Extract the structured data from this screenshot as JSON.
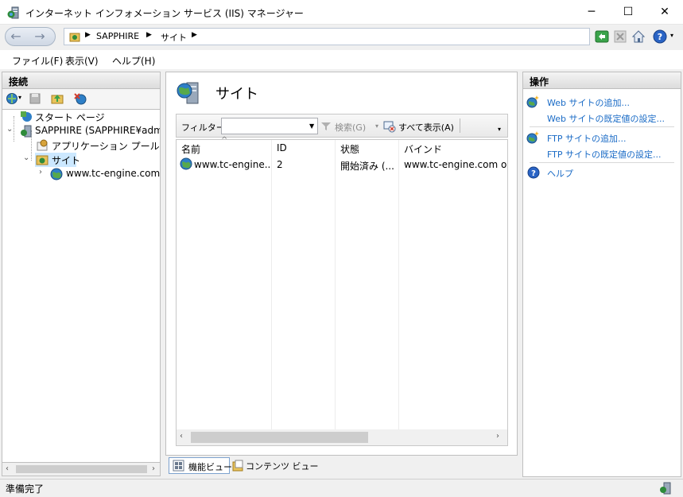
{
  "window": {
    "title": "インターネット インフォメーション サービス (IIS) マネージャー",
    "minimize": "─",
    "maximize": "☐",
    "close": "✕"
  },
  "address": {
    "back": "←",
    "forward": "→",
    "separator": "▶",
    "crumbs": [
      "SAPPHIRE",
      "サイト"
    ],
    "help_arrow": "▾"
  },
  "menu": {
    "file": "ファイル(F)",
    "view": "表示(V)",
    "help": "ヘルプ(H)"
  },
  "connections": {
    "header": "接続",
    "tree": [
      {
        "label": "スタート ページ",
        "icon": "start-page-icon"
      },
      {
        "label": "SAPPHIRE (SAPPHIRE¥administrator)",
        "expander": "⌄",
        "icon": "server-icon"
      },
      {
        "label": "アプリケーション プール",
        "icon": "app-pool-icon"
      },
      {
        "label": "サイト",
        "expander": "⌄",
        "icon": "sites-folder-icon",
        "selected": true
      },
      {
        "label": "www.tc-engine.com",
        "expander": "›",
        "icon": "globe-icon"
      }
    ]
  },
  "main": {
    "title": "サイト",
    "filter": {
      "label": "フィルター:",
      "value": "",
      "go_label": "検索(G)",
      "show_all_label": "すべて表示(A)"
    },
    "columns": [
      "名前",
      "ID",
      "状態",
      "バインド"
    ],
    "rows": [
      {
        "name": "www.tc-engine....",
        "id": "2",
        "status": "開始済み (...",
        "binding": "www.tc-engine.com on *"
      }
    ],
    "view_tabs": {
      "features": "機能ビュー",
      "content": "コンテンツ ビュー"
    }
  },
  "actions": {
    "header": "操作",
    "items": [
      "Web サイトの追加...",
      "Web サイトの既定値の設定...",
      "FTP サイトの追加...",
      "FTP サイトの既定値の設定...",
      "ヘルプ"
    ]
  },
  "status": {
    "text": "準備完了"
  },
  "colors": {
    "link": "#1a6bc6",
    "selection": "#cce8ff"
  }
}
